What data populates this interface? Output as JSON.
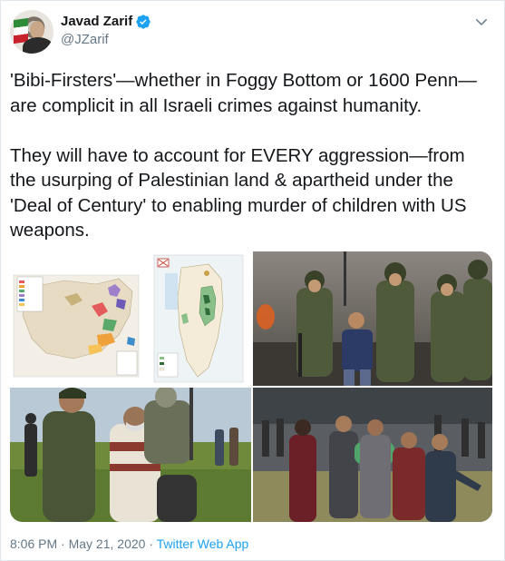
{
  "author": {
    "name": "Javad Zarif",
    "handle": "@JZarif",
    "verified": true,
    "avatar_icon": "avatar-photo"
  },
  "tweet": {
    "text": "'Bibi-Firsters'—whether in Foggy Bottom or 1600 Penn—are complicit in all Israeli crimes against humanity.\n\nThey will have to account for EVERY aggression—from the usurping of Palestinian land & apartheid under the 'Deal of Century' to enabling murder of children with US weapons."
  },
  "media": {
    "count": 5,
    "images": [
      {
        "label": "map-of-territories"
      },
      {
        "label": "map-israel-annexation"
      },
      {
        "label": "soldiers-detaining-boy"
      },
      {
        "label": "soldier-arresting-man"
      },
      {
        "label": "crowd-carrying-injured-person"
      }
    ]
  },
  "footer": {
    "time": "8:06 PM",
    "separator": "·",
    "date": "May 21, 2020",
    "source": "Twitter Web App"
  },
  "colors": {
    "accent": "#1da1f2",
    "secondary_text": "#657786",
    "primary_text": "#14171a"
  },
  "icons": {
    "verified": "verified-badge-icon",
    "menu": "chevron-down-icon"
  }
}
